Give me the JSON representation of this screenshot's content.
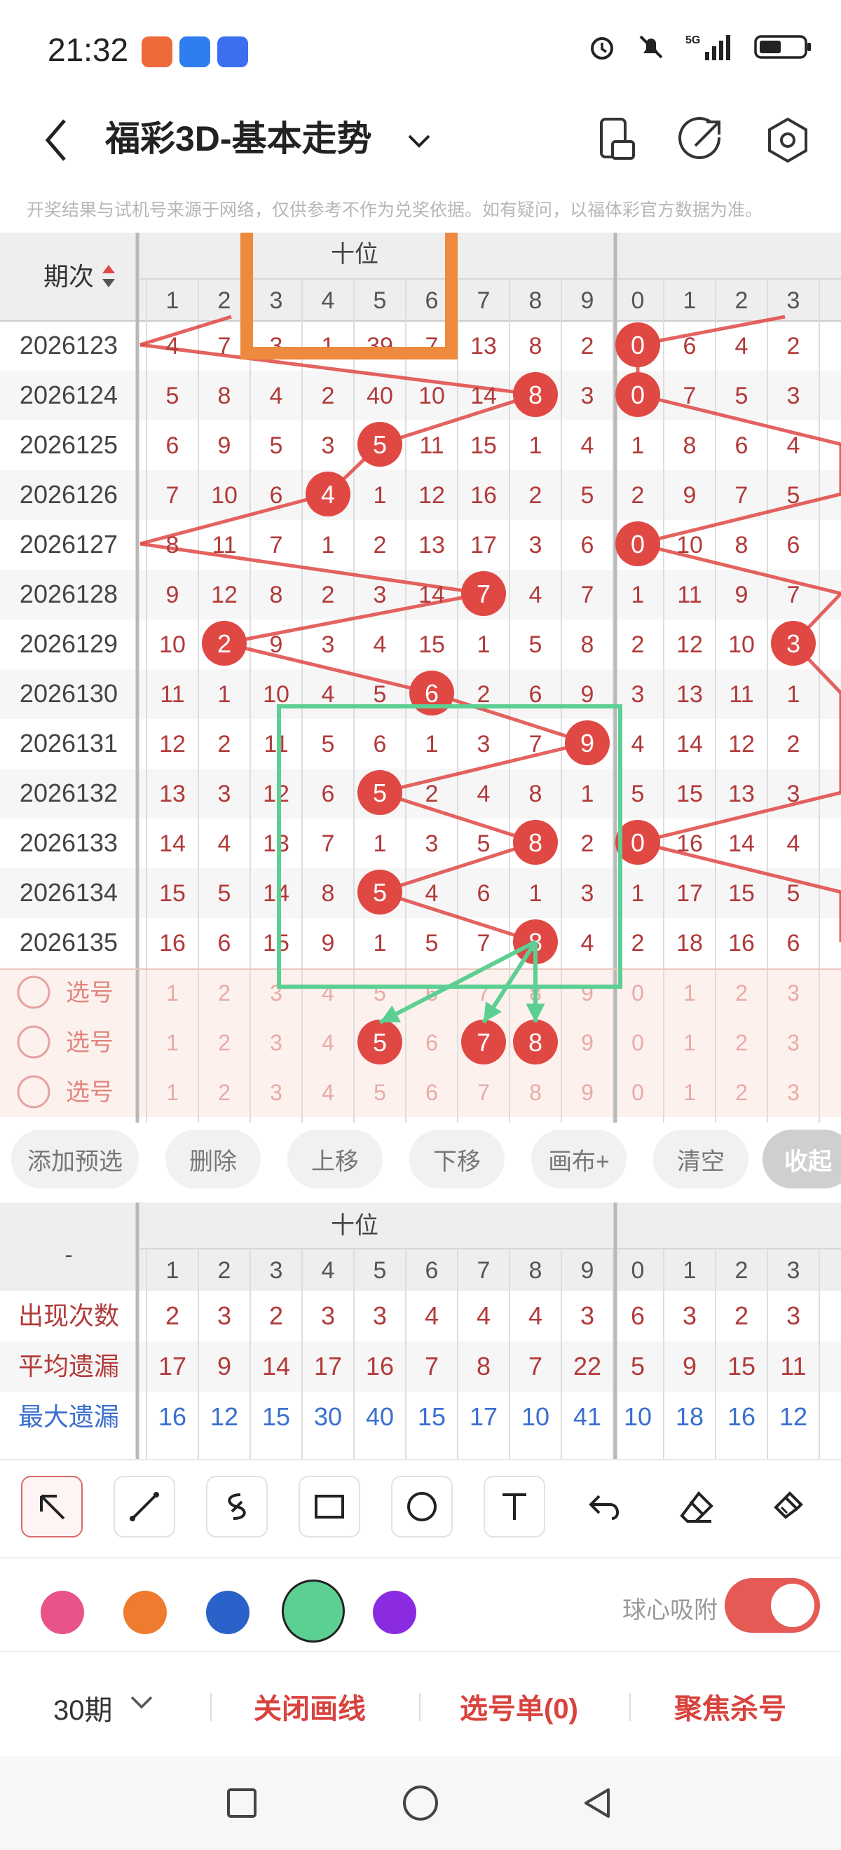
{
  "status": {
    "time": "21:32",
    "network": "5G"
  },
  "header": {
    "title": "福彩3D-基本走势"
  },
  "disclaimer": "开奖结果与试机号来源于网络，仅供参考不作为兑奖依据。如有疑问，以福体彩官方数据为准。",
  "trend": {
    "period_header": "期次",
    "group_label": "十位",
    "tens_digits": [
      "1",
      "2",
      "3",
      "4",
      "5",
      "6",
      "7",
      "8",
      "9"
    ],
    "units_digits": [
      "0",
      "1",
      "2",
      "3"
    ],
    "rows": [
      {
        "issue": "2026123",
        "tens": [
          "4",
          "7",
          "3",
          "1",
          "39",
          "7",
          "13",
          "8",
          "2"
        ],
        "tens_hit": null,
        "units": [
          "0",
          "6",
          "4",
          "2"
        ],
        "units_hit": 0
      },
      {
        "issue": "2026124",
        "tens": [
          "5",
          "8",
          "4",
          "2",
          "40",
          "10",
          "14",
          "8",
          "3"
        ],
        "tens_hit": 7,
        "units": [
          "0",
          "7",
          "5",
          "3"
        ],
        "units_hit": 0
      },
      {
        "issue": "2026125",
        "tens": [
          "6",
          "9",
          "5",
          "3",
          "5",
          "11",
          "15",
          "1",
          "4"
        ],
        "tens_hit": 4,
        "units": [
          "1",
          "8",
          "6",
          "4"
        ],
        "units_hit": null
      },
      {
        "issue": "2026126",
        "tens": [
          "7",
          "10",
          "6",
          "4",
          "1",
          "12",
          "16",
          "2",
          "5"
        ],
        "tens_hit": 3,
        "units": [
          "2",
          "9",
          "7",
          "5"
        ],
        "units_hit": null
      },
      {
        "issue": "2026127",
        "tens": [
          "8",
          "11",
          "7",
          "1",
          "2",
          "13",
          "17",
          "3",
          "6"
        ],
        "tens_hit": null,
        "units": [
          "0",
          "10",
          "8",
          "6"
        ],
        "units_hit": 0
      },
      {
        "issue": "2026128",
        "tens": [
          "9",
          "12",
          "8",
          "2",
          "3",
          "14",
          "7",
          "4",
          "7"
        ],
        "tens_hit": 6,
        "units": [
          "1",
          "11",
          "9",
          "7"
        ],
        "units_hit": null
      },
      {
        "issue": "2026129",
        "tens": [
          "10",
          "2",
          "9",
          "3",
          "4",
          "15",
          "1",
          "5",
          "8"
        ],
        "tens_hit": 1,
        "units": [
          "2",
          "12",
          "10",
          "3"
        ],
        "units_hit": 3
      },
      {
        "issue": "2026130",
        "tens": [
          "11",
          "1",
          "10",
          "4",
          "5",
          "6",
          "2",
          "6",
          "9"
        ],
        "tens_hit": 5,
        "units": [
          "3",
          "13",
          "11",
          "1"
        ],
        "units_hit": null
      },
      {
        "issue": "2026131",
        "tens": [
          "12",
          "2",
          "11",
          "5",
          "6",
          "1",
          "3",
          "7",
          "9"
        ],
        "tens_hit": 8,
        "units": [
          "4",
          "14",
          "12",
          "2"
        ],
        "units_hit": null
      },
      {
        "issue": "2026132",
        "tens": [
          "13",
          "3",
          "12",
          "6",
          "5",
          "2",
          "4",
          "8",
          "1"
        ],
        "tens_hit": 4,
        "units": [
          "5",
          "15",
          "13",
          "3"
        ],
        "units_hit": null
      },
      {
        "issue": "2026133",
        "tens": [
          "14",
          "4",
          "13",
          "7",
          "1",
          "3",
          "5",
          "8",
          "2"
        ],
        "tens_hit": 7,
        "units": [
          "0",
          "16",
          "14",
          "4"
        ],
        "units_hit": 0
      },
      {
        "issue": "2026134",
        "tens": [
          "15",
          "5",
          "14",
          "8",
          "5",
          "4",
          "6",
          "1",
          "3"
        ],
        "tens_hit": 4,
        "units": [
          "1",
          "17",
          "15",
          "5"
        ],
        "units_hit": null
      },
      {
        "issue": "2026135",
        "tens": [
          "16",
          "6",
          "15",
          "9",
          "1",
          "5",
          "7",
          "8",
          "4"
        ],
        "tens_hit": 7,
        "units": [
          "2",
          "18",
          "16",
          "6"
        ],
        "units_hit": null
      }
    ],
    "pick_label": "选号",
    "pick_rows": [
      {
        "tens_selected": []
      },
      {
        "tens_selected": [
          4,
          6,
          7
        ]
      },
      {
        "tens_selected": []
      }
    ]
  },
  "actions": [
    "添加预选",
    "删除",
    "上移",
    "下移",
    "画布+",
    "清空",
    "收起"
  ],
  "stats": {
    "corner": "-",
    "group_label": "十位",
    "tens_digits": [
      "1",
      "2",
      "3",
      "4",
      "5",
      "6",
      "7",
      "8",
      "9"
    ],
    "units_digits": [
      "0",
      "1",
      "2",
      "3"
    ],
    "rows": [
      {
        "label": "出现次数",
        "color": "#b23a3a",
        "values": [
          "2",
          "3",
          "2",
          "3",
          "3",
          "4",
          "4",
          "4",
          "3",
          "6",
          "3",
          "2",
          "3"
        ]
      },
      {
        "label": "平均遗漏",
        "color": "#b23a3a",
        "values": [
          "17",
          "9",
          "14",
          "17",
          "16",
          "7",
          "8",
          "7",
          "22",
          "5",
          "9",
          "15",
          "11"
        ]
      },
      {
        "label": "最大遗漏",
        "color": "#3a6fd0",
        "values": [
          "16",
          "12",
          "15",
          "30",
          "40",
          "15",
          "17",
          "10",
          "41",
          "10",
          "18",
          "16",
          "12"
        ]
      }
    ]
  },
  "drawing_tools": [
    "arrow-tool",
    "line-tool",
    "freehand-tool",
    "rectangle-tool",
    "circle-tool",
    "text-tool",
    "undo-tool",
    "eraser-tool",
    "clear-brush-tool"
  ],
  "colors": [
    "#e8548a",
    "#ee7b2e",
    "#2a62c9",
    "#5ccf93",
    "#8a2be2"
  ],
  "selected_color": "#5ccf93",
  "snap_label": "球心吸附",
  "snap_enabled": true,
  "bottom": {
    "period": "30期",
    "close_lines": "关闭画线",
    "pick_list": "选号单(0)",
    "focus_kill": "聚焦杀号"
  },
  "accent": "#e04844"
}
